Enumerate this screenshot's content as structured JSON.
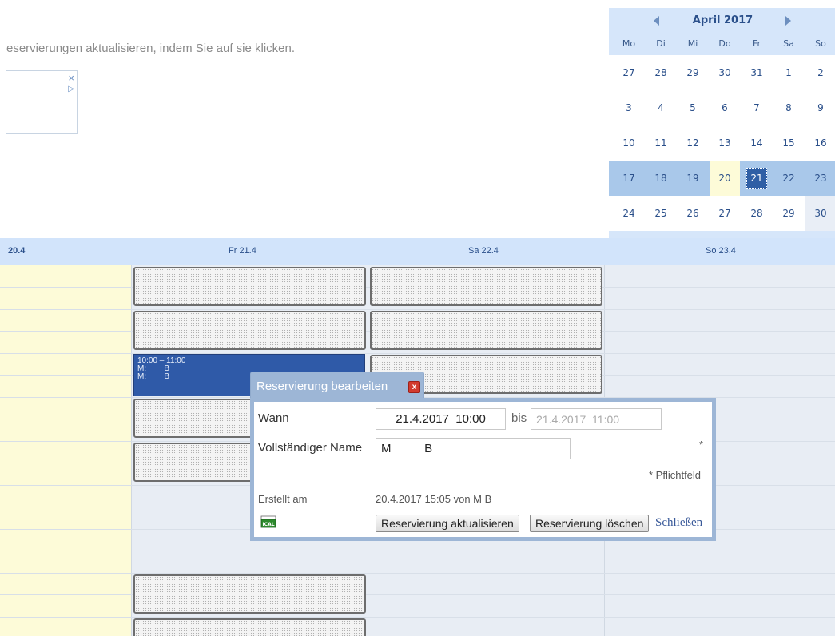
{
  "intro_text": "eservierungen aktualisieren, indem Sie auf sie klicken.",
  "ad": {
    "close_icon": "×",
    "play_icon": "▷"
  },
  "mini_calendar": {
    "title": "April 2017",
    "weekdays": [
      "Mo",
      "Di",
      "Mi",
      "Do",
      "Fr",
      "Sa",
      "So"
    ],
    "weeks": [
      [
        "27",
        "28",
        "29",
        "30",
        "31",
        "1",
        "2"
      ],
      [
        "3",
        "4",
        "5",
        "6",
        "7",
        "8",
        "9"
      ],
      [
        "10",
        "11",
        "12",
        "13",
        "14",
        "15",
        "16"
      ],
      [
        "17",
        "18",
        "19",
        "20",
        "21",
        "22",
        "23"
      ],
      [
        "24",
        "25",
        "26",
        "27",
        "28",
        "29",
        "30"
      ]
    ],
    "selected_day": "21",
    "today": "20"
  },
  "week_view": {
    "day_headers": [
      "20.4",
      "Fr 21.4",
      "Sa 22.4",
      "So 23.4"
    ]
  },
  "booking": {
    "time": "10:00 – 11:00",
    "line1": "M:        B",
    "line2": "M:        B"
  },
  "dialog": {
    "title": "Reservierung bearbeiten",
    "close_icon": "x",
    "when_label": "Wann",
    "from_value": "21.4.2017  10:00",
    "bis_label": "bis",
    "to_value": "21.4.2017  11:00",
    "name_label": "Vollständiger Name",
    "name_value": "M          B",
    "required_marker": "*",
    "required_note": "* Pflichtfeld",
    "created_label": "Erstellt am",
    "created_value": "20.4.2017 15:05 von M          B",
    "ical_icon": "ICAL",
    "update_button": "Reservierung aktualisieren",
    "delete_button": "Reservierung löschen",
    "close_link": "Schließen"
  },
  "colors": {
    "calendar_bg": "#d6e6fa",
    "selected_week": "#a9c8ea",
    "selected_day": "#2f5fa5",
    "today_bg": "#fdfbd8",
    "booking_bg": "#2f5aa8",
    "dialog_border": "#9db6d6"
  }
}
